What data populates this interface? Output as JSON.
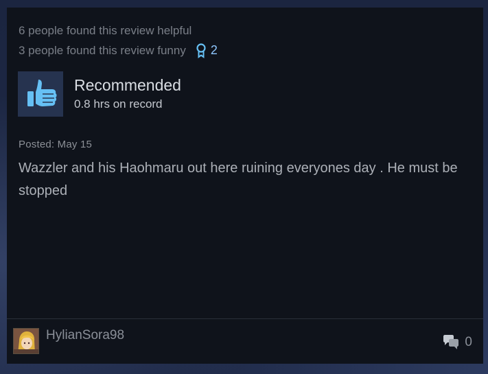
{
  "review": {
    "helpful_text": "6 people found this review helpful",
    "funny_text": "3 people found this review funny",
    "award_icon": "award-ribbon-icon",
    "award_count": "2",
    "recommendation": "Recommended",
    "hours": "0.8 hrs on record",
    "posted": "Posted: May 15",
    "body": "Wazzler and his Haohmaru out here ruining everyones day . He must be stopped"
  },
  "author": {
    "name": "HylianSora98",
    "avatar_icon": "user-avatar"
  },
  "comments": {
    "icon": "comment-bubbles-icon",
    "count": "0"
  },
  "colors": {
    "card_bg": "#0f131b",
    "thumb_bg": "#26334f",
    "thumb_color": "#66c0f4",
    "award_color": "#66c0f4"
  }
}
